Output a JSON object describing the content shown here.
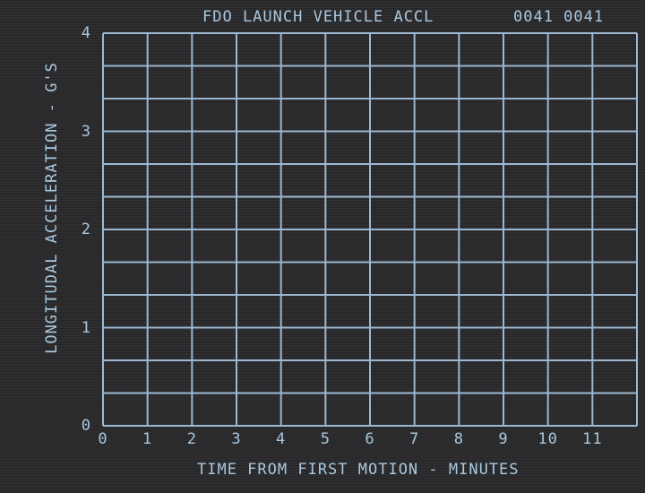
{
  "display": {
    "title": "FDO LAUNCH VEHICLE ACCL",
    "codes": "0041 0041",
    "colors": {
      "background": "#2e2e30",
      "grid": "#9bb8d0",
      "text": "#a9c8df"
    }
  },
  "chart_data": {
    "type": "line",
    "title": "FDO LAUNCH VEHICLE ACCL",
    "xlabel": "TIME FROM FIRST MOTION - MINUTES",
    "ylabel": "LONGITUDAL ACCELERATION - G'S",
    "xlim": [
      0,
      12
    ],
    "ylim": [
      0,
      4
    ],
    "x_ticks": [
      "0",
      "1",
      "2",
      "3",
      "4",
      "5",
      "6",
      "7",
      "8",
      "9",
      "10",
      "11"
    ],
    "y_ticks": [
      "0",
      "1",
      "2",
      "3",
      "4"
    ],
    "grid": true,
    "series": []
  }
}
